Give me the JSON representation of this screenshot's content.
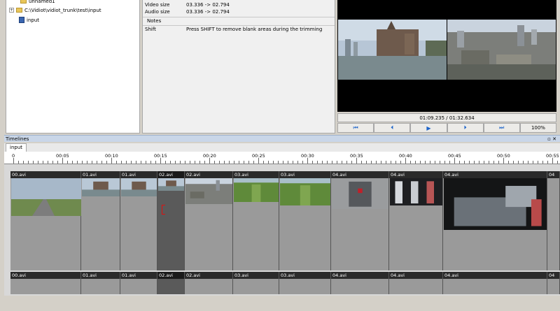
{
  "project_tree": {
    "root_label": "unnamed1",
    "folder_label": "C:\\Vidiot\\vidiot_trunk\\test\\input",
    "file_label": "input"
  },
  "details": {
    "video_size_label": "Video size",
    "video_size_value": "03.336 -> 02.794",
    "audio_size_label": "Audio size",
    "audio_size_value": "03.336 -> 02.794",
    "notes_header": "Notes",
    "shift_label": "Shift",
    "shift_value": "Press SHIFT to remove blank areas during the trimming"
  },
  "preview": {
    "time": "01:09.235 / 01:32.634",
    "zoom": "100%",
    "controls": [
      "skip-to-start-icon",
      "previous-icon",
      "play-icon",
      "next-icon",
      "skip-to-end-icon"
    ]
  },
  "timelines": {
    "title": "Timelines",
    "window_buttons": "▫ ✕",
    "tab": "input",
    "ruler": [
      "0",
      "00:05",
      "00:10",
      "00:15",
      "00:20",
      "00:25",
      "00:30",
      "00:35",
      "00:40",
      "00:45",
      "00:50",
      "00:55"
    ],
    "video_clips": [
      {
        "name": "00.avi",
        "scene": "road"
      },
      {
        "name": "01.avi",
        "scene": "castle"
      },
      {
        "name": "01.avi",
        "scene": "castle"
      },
      {
        "name": "02.avi",
        "scene": "castle"
      },
      {
        "name": "02.avi",
        "scene": "city"
      },
      {
        "name": "03.avi",
        "scene": "green"
      },
      {
        "name": "03.avi",
        "scene": "green"
      },
      {
        "name": "04.avi",
        "scene": "elevator"
      },
      {
        "name": "04.avi",
        "scene": "glass"
      },
      {
        "name": "04.avi",
        "scene": "interior"
      },
      {
        "name": "04",
        "scene": ""
      }
    ],
    "audio_clips": [
      "00.avi",
      "01.avi",
      "01.avi",
      "02.avi",
      "02.avi",
      "03.avi",
      "03.avi",
      "04.avi",
      "04.avi",
      "04.avi",
      "04"
    ]
  },
  "colors": {
    "timeline_header": "#c9d6e8",
    "control_accent": "#1d64c9",
    "trim_marker": "#e01010"
  }
}
